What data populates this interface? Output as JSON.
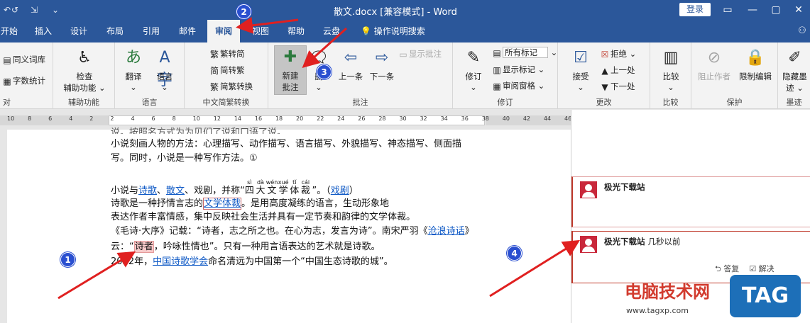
{
  "titlebar": {
    "title": "散文.docx [兼容模式] - Word",
    "login": "登录",
    "qat_icons": [
      "↶",
      "↺",
      "⇲",
      "⌄"
    ],
    "window_controls": [
      "▭",
      "—",
      "▢",
      "✕"
    ]
  },
  "tabs": [
    "开始",
    "插入",
    "设计",
    "布局",
    "引用",
    "邮件",
    "审阅",
    "视图",
    "帮助",
    "云盘"
  ],
  "active_tab": "审阅",
  "tell_me": "操作说明搜索",
  "ribbon": {
    "proofing": {
      "thesaurus": "同义词库",
      "word_count": "字数统计",
      "label": "对"
    },
    "accessibility": {
      "check": "检查",
      "check2": "辅助功能",
      "label": "辅助功能"
    },
    "language": {
      "translate": "翻译",
      "language": "语言",
      "label": "语言"
    },
    "chinese": {
      "to_trad": "繁转简",
      "to_simp": "简转繁",
      "convert": "简繁转换",
      "label": "中文简繁转换"
    },
    "comments": {
      "new1": "新建",
      "new2": "批注",
      "delete": "删",
      "prev": "上一条",
      "next": "下一条",
      "show": "显示批注",
      "label": "批注"
    },
    "tracking": {
      "track": "修订",
      "all_markup": "所有标记",
      "show_markup": "显示标记",
      "pane": "审阅窗格",
      "label": "修订"
    },
    "changes": {
      "accept": "接受",
      "reject": "拒绝",
      "prev": "上一处",
      "next": "下一处",
      "label": "更改"
    },
    "compare": {
      "compare": "比较",
      "label": "比较"
    },
    "protect": {
      "block": "阻止作者",
      "restrict": "限制编辑",
      "label": "保护"
    },
    "ink": {
      "hide1": "隐藏墨",
      "hide2": "迹",
      "label": "墨迹"
    }
  },
  "ruler_numbers": [
    "10",
    "8",
    "6",
    "4",
    "2",
    "2",
    "4",
    "6",
    "8",
    "10",
    "12",
    "14",
    "16",
    "18",
    "20",
    "22",
    "24",
    "26",
    "28",
    "30",
    "32",
    "34",
    "36",
    "38",
    "40",
    "42",
    "44",
    "46"
  ],
  "document": {
    "line0": "说。按照名方式为为贝们了说和口语了说。",
    "line1": "小说刻画人物的方法：心理描写、动作描写、语言描写、外貌描写、神态描写、侧面描",
    "line2": "写。同时，小说是一种写作方法。①",
    "line3_pre": "小说与",
    "line3_link1": "诗歌",
    "line3_sep": "、",
    "line3_link2": "散文",
    "line3_mid": "、戏剧，并称“",
    "line3_ruby": [
      {
        "char": "四",
        "py": "sì"
      },
      {
        "char": "大",
        "py": "dà"
      },
      {
        "char": "文",
        "py": "wén"
      },
      {
        "char": "学",
        "py": "xué"
      },
      {
        "char": "体",
        "py": "tǐ"
      },
      {
        "char": "裁",
        "py": "cái"
      }
    ],
    "line3_post": "”。（",
    "line3_link3": "戏剧",
    "line3_end": "）",
    "line4_pre": "诗歌是一种抒情言志的",
    "line4_link": "文学体裁",
    "line4_post": "。是用高度凝练的语言，生动形象地",
    "line5": "表达作者丰富情感，集中反映社会生活并具有一定节奏和韵律的文学体裁。",
    "line6_pre": "《毛诗·大序》记载：“诗者，志之所之也。在心为志，发言为诗”。南宋严羽《",
    "line6_link": "沧浪诗话",
    "line6_post": "》",
    "line7_pre": "云：“",
    "line7_hl": "诗者",
    "line7_post": "，吟咏性情也”。只有一种用言语表达的艺术就是诗歌。",
    "line8_pre": "2022年，",
    "line8_link": "中国诗歌学会",
    "line8_post": "命名清远为中国第一个“中国生态诗歌的城”。"
  },
  "comments": [
    {
      "author": "极光下载站",
      "time": ""
    },
    {
      "author": "极光下载站",
      "time": "几秒以前",
      "reply": "答复",
      "resolve": "解决"
    }
  ],
  "badges": [
    "1",
    "2",
    "3",
    "4"
  ],
  "watermark": {
    "text": "电脑技术网",
    "url": "www.tagxp.com",
    "logo": "TAG"
  },
  "colors": {
    "accent": "#2b579a",
    "arrow": "#e02020",
    "badge": "#2a4fd0",
    "comment": "#c0392b"
  }
}
